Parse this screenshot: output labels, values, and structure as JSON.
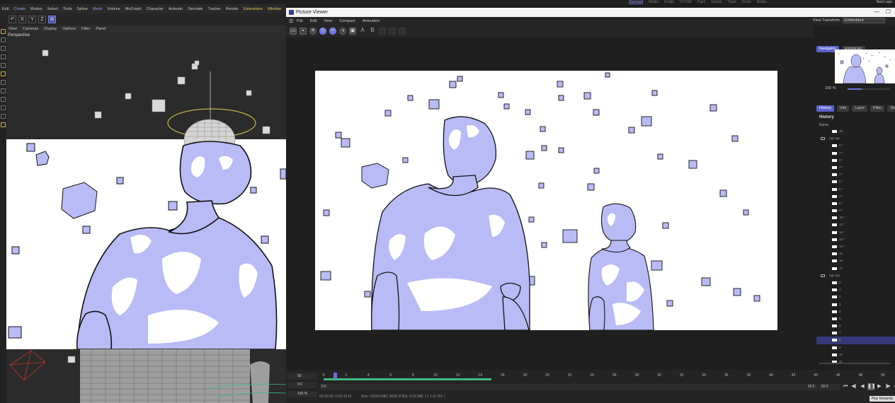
{
  "top_tabs": [
    "Standard",
    "Model",
    "Sculpt",
    "UV Edit",
    "Paint",
    "Groom",
    "Track",
    "Script",
    "Nodes"
  ],
  "top_user": "New Layo",
  "c4d": {
    "menu": [
      "Edit",
      "Create",
      "Modes",
      "Select",
      "Tools",
      "Spline",
      "Mesh",
      "Volume",
      "MoGraph",
      "Character",
      "Animate",
      "Simulate",
      "Tracker",
      "Render",
      "Extensions",
      "Window"
    ],
    "axes": [
      "X",
      "Y",
      "Z"
    ],
    "viewport_menu": [
      "View",
      "Cameras",
      "Display",
      "Options",
      "Filter",
      "Panel"
    ],
    "viewport_label": "Perspective"
  },
  "picture_viewer": {
    "title": "Picture Viewer",
    "menu": [
      "File",
      "Edit",
      "View",
      "Compare",
      "Animation"
    ],
    "view_transform_label": "View Transform",
    "view_transform_value": "Embedded",
    "toolbar_letters": [
      "A",
      "B"
    ],
    "side_tabs_top": [
      "Navigator",
      "Histogram"
    ],
    "zoom": "100 %",
    "zoom_level": 0.33,
    "side_tabs": [
      "History",
      "Info",
      "Layer",
      "Filter",
      "Stereo"
    ],
    "history_title": "History",
    "history_name_col": "Name",
    "history_rows": [
      {
        "label": "3d",
        "group": false
      },
      {
        "label": "ngz two",
        "group": true
      },
      {
        "label": "0 *",
        "group": false
      },
      {
        "label": "1 *",
        "group": false
      },
      {
        "label": "2 *",
        "group": false
      },
      {
        "label": "3 *",
        "group": false
      },
      {
        "label": "4 *",
        "group": false
      },
      {
        "label": "5 *",
        "group": false
      },
      {
        "label": "6 *",
        "group": false
      },
      {
        "label": "7 *",
        "group": false
      },
      {
        "label": "8 *",
        "group": false
      },
      {
        "label": "9 *",
        "group": false
      },
      {
        "label": "10 *",
        "group": false
      },
      {
        "label": "11 *",
        "group": false
      },
      {
        "label": "12 *",
        "group": false
      },
      {
        "label": "13 *",
        "group": false
      },
      {
        "label": "14 *",
        "group": false
      },
      {
        "label": "15",
        "group": false
      },
      {
        "label": "16",
        "group": false
      },
      {
        "label": "17",
        "group": false
      },
      {
        "label": "ngz two",
        "group": true
      },
      {
        "label": "0",
        "group": false
      },
      {
        "label": "1",
        "group": false
      },
      {
        "label": "2",
        "group": false
      },
      {
        "label": "3",
        "group": false
      },
      {
        "label": "4",
        "group": false
      },
      {
        "label": "5",
        "group": false
      },
      {
        "label": "6",
        "group": false
      },
      {
        "label": "7",
        "group": false
      },
      {
        "label": "8",
        "group": false,
        "selected": true
      },
      {
        "label": "9",
        "group": false
      },
      {
        "label": "10",
        "group": false
      },
      {
        "label": "11",
        "group": false
      }
    ],
    "timeline": {
      "field_fps": "50",
      "field_frame": "0 F",
      "field_zoom": "100 %",
      "ticks": [
        "0",
        "2",
        "4",
        "6",
        "8",
        "10",
        "12",
        "14",
        "16",
        "18",
        "20",
        "22",
        "24",
        "26",
        "28",
        "30",
        "32",
        "34",
        "36",
        "38",
        "40",
        "42",
        "44",
        "46",
        "48",
        "50"
      ],
      "bar_start": "0 F",
      "bar_end": "50 F",
      "end_field": "50 F",
      "controls": [
        "⏮",
        "◀|",
        "◀",
        "❚❚",
        "▶",
        "|▶",
        "⏭"
      ],
      "info": [
        "00:00:00 +/151 (0 F)",
        "Size: 1920x1080, RGB (8 Bit), 6.03 MB,  ( F 2 of 151 )"
      ],
      "tooltip": "Play forwards"
    }
  },
  "colors": {
    "figure": "#b9bbf6",
    "accent": "#6c72d8",
    "progress": "#3dbb7f"
  }
}
